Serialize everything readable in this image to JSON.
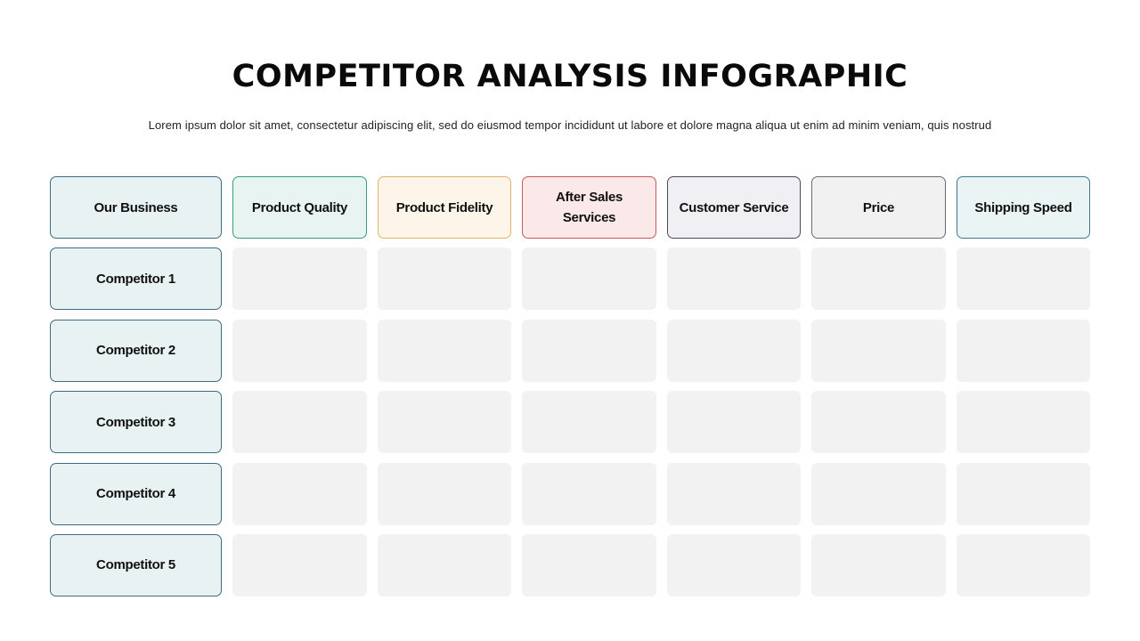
{
  "title": "COMPETITOR ANALYSIS INFOGRAPHIC",
  "subtitle": "Lorem ipsum dolor sit amet, consectetur adipiscing elit, sed do eiusmod tempor incididunt ut labore et dolore magna aliqua ut enim ad minim veniam, quis nostrud",
  "table": {
    "corner": "Our Business",
    "columns": [
      {
        "label": "Product Quality",
        "border": "#3a9a80",
        "fill": "#e7f4f1"
      },
      {
        "label": "Product Fidelity",
        "border": "#e1b36a",
        "fill": "#fdf5ea"
      },
      {
        "label": "After Sales Services",
        "border": "#c85a5a",
        "fill": "#fbe9e9"
      },
      {
        "label": "Customer Service",
        "border": "#4a4a5a",
        "fill": "#f0eff3"
      },
      {
        "label": "Price",
        "border": "#6a6a6a",
        "fill": "#f1f1f1"
      },
      {
        "label": "Shipping Speed",
        "border": "#3f7a8a",
        "fill": "#eaf4f4"
      }
    ],
    "rows": [
      {
        "label": "Competitor 1",
        "cells": [
          "",
          "",
          "",
          "",
          "",
          ""
        ]
      },
      {
        "label": "Competitor 2",
        "cells": [
          "",
          "",
          "",
          "",
          "",
          ""
        ]
      },
      {
        "label": "Competitor 3",
        "cells": [
          "",
          "",
          "",
          "",
          "",
          ""
        ]
      },
      {
        "label": "Competitor 4",
        "cells": [
          "",
          "",
          "",
          "",
          "",
          ""
        ]
      },
      {
        "label": "Competitor 5",
        "cells": [
          "",
          "",
          "",
          "",
          "",
          ""
        ]
      }
    ]
  }
}
